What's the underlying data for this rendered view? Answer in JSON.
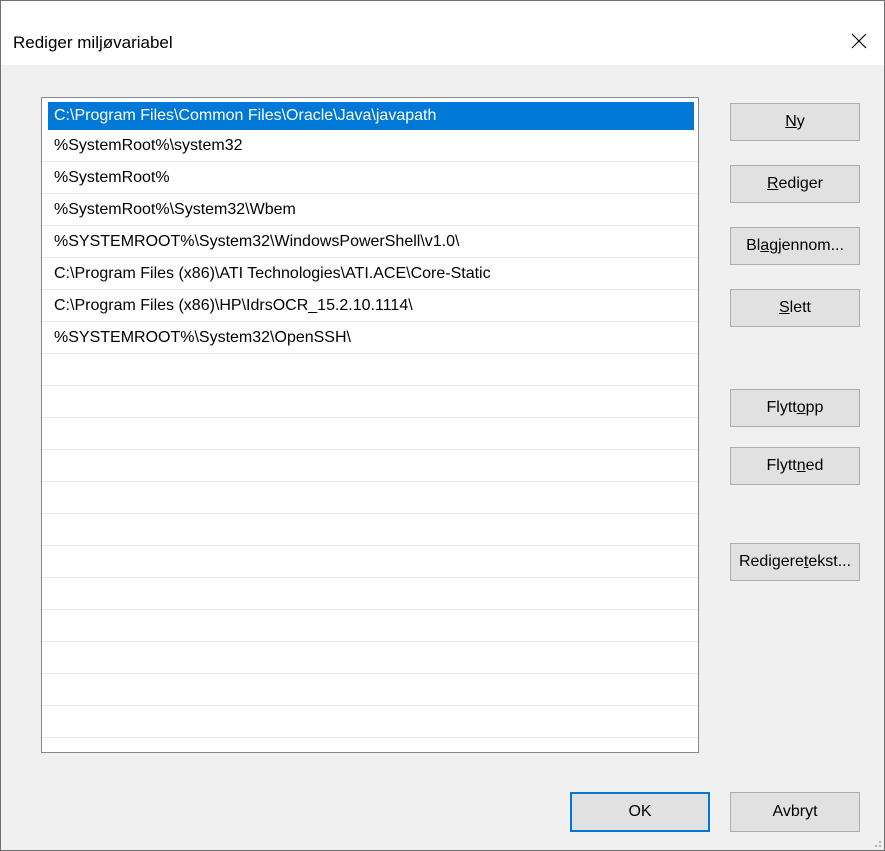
{
  "window": {
    "title": "Rediger miljøvariabel"
  },
  "list": {
    "items": [
      "C:\\Program Files\\Common Files\\Oracle\\Java\\javapath",
      "%SystemRoot%\\system32",
      "%SystemRoot%",
      "%SystemRoot%\\System32\\Wbem",
      "%SYSTEMROOT%\\System32\\WindowsPowerShell\\v1.0\\",
      "C:\\Program Files (x86)\\ATI Technologies\\ATI.ACE\\Core-Static",
      "C:\\Program Files (x86)\\HP\\IdrsOCR_15.2.10.1114\\",
      "%SYSTEMROOT%\\System32\\OpenSSH\\"
    ],
    "selected_index": 0,
    "empty_rows": 12
  },
  "buttons": {
    "new": {
      "pre": "",
      "u": "N",
      "post": "y"
    },
    "edit": {
      "pre": "",
      "u": "R",
      "post": "ediger"
    },
    "browse": {
      "pre": "Bl",
      "u": "a",
      "post": " gjennom..."
    },
    "delete": {
      "pre": "",
      "u": "S",
      "post": "lett"
    },
    "move_up": {
      "pre": "Flytt ",
      "u": "o",
      "post": "pp"
    },
    "move_down": {
      "pre": "Flytt ",
      "u": "n",
      "post": "ed"
    },
    "edit_text": {
      "pre": "Redigere ",
      "u": "t",
      "post": "ekst..."
    },
    "ok": "OK",
    "cancel": "Avbryt"
  },
  "colors": {
    "selection": "#0078d7",
    "button_face": "#e1e1e1",
    "dialog_bg": "#f0f0f0"
  },
  "icons": {
    "close": "close-icon"
  }
}
